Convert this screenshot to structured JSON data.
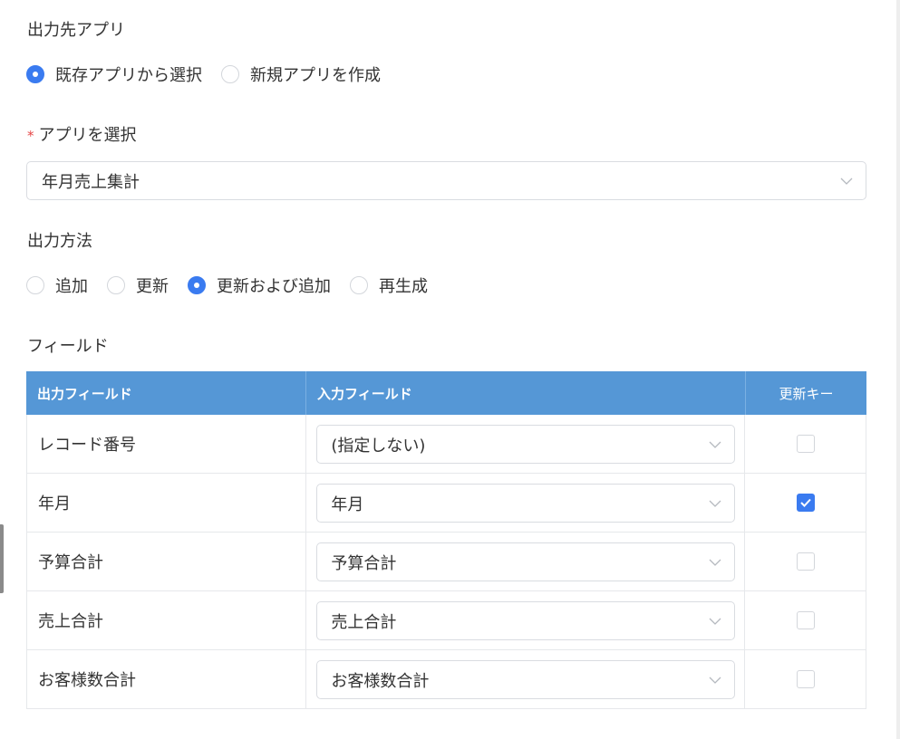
{
  "output_target": {
    "label": "出力先アプリ",
    "options": [
      {
        "label": "既存アプリから選択",
        "checked": true
      },
      {
        "label": "新規アプリを作成",
        "checked": false
      }
    ]
  },
  "app_select": {
    "required_mark": "*",
    "label": "アプリを選択",
    "value": "年月売上集計"
  },
  "output_method": {
    "label": "出力方法",
    "options": [
      {
        "label": "追加",
        "checked": false
      },
      {
        "label": "更新",
        "checked": false
      },
      {
        "label": "更新および追加",
        "checked": true
      },
      {
        "label": "再生成",
        "checked": false
      }
    ]
  },
  "fields": {
    "label": "フィールド",
    "headers": {
      "output_field": "出力フィールド",
      "input_field": "入力フィールド",
      "update_key": "更新キー"
    },
    "rows": [
      {
        "output": "レコード番号",
        "input": "(指定しない)",
        "update_key": false
      },
      {
        "output": "年月",
        "input": "年月",
        "update_key": true
      },
      {
        "output": "予算合計",
        "input": "予算合計",
        "update_key": false
      },
      {
        "output": "売上合計",
        "input": "売上合計",
        "update_key": false
      },
      {
        "output": "お客様数合計",
        "input": "お客様数合計",
        "update_key": false
      }
    ]
  },
  "colors": {
    "accent": "#3a7bf0",
    "header_bg": "#5597d6",
    "required": "#e54545"
  },
  "icons": {
    "dropdown": "chevron-down-icon",
    "check": "check-icon"
  }
}
